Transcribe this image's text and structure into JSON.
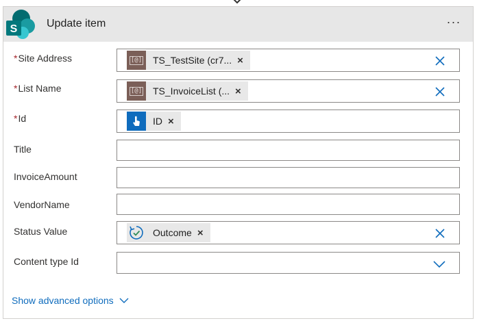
{
  "action": {
    "title": "Update item",
    "menu_label": "···"
  },
  "fields": [
    {
      "label": "Site Address",
      "required": true,
      "token": {
        "text": "TS_TestSite (cr7...",
        "icon": "sharepoint-variable-icon"
      },
      "clearable": true
    },
    {
      "label": "List Name",
      "required": true,
      "token": {
        "text": "TS_InvoiceList (...",
        "icon": "sharepoint-variable-icon"
      },
      "clearable": true
    },
    {
      "label": "Id",
      "required": true,
      "token": {
        "text": "ID",
        "icon": "manual-trigger-icon"
      },
      "clearable": false
    },
    {
      "label": "Title",
      "required": false,
      "value": ""
    },
    {
      "label": "InvoiceAmount",
      "required": false,
      "value": ""
    },
    {
      "label": "VendorName",
      "required": false,
      "value": ""
    },
    {
      "label": "Status Value",
      "required": false,
      "token": {
        "text": "Outcome",
        "icon": "approval-icon"
      },
      "clearable": true
    },
    {
      "label": "Content type Id",
      "required": false,
      "value": "",
      "dropdown": true
    }
  ],
  "required_marker": "*",
  "token_remove": "×",
  "show_advanced_label": "Show advanced options",
  "colors": {
    "accent": "#0f6cbd",
    "required": "#a4262c",
    "header_bg": "#e7e7e7"
  }
}
